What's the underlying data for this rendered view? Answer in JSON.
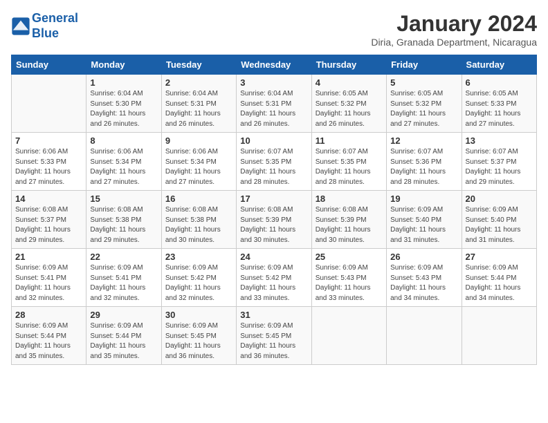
{
  "header": {
    "logo_line1": "General",
    "logo_line2": "Blue",
    "title": "January 2024",
    "subtitle": "Diria, Granada Department, Nicaragua"
  },
  "days_of_week": [
    "Sunday",
    "Monday",
    "Tuesday",
    "Wednesday",
    "Thursday",
    "Friday",
    "Saturday"
  ],
  "weeks": [
    [
      {
        "day": "",
        "info": ""
      },
      {
        "day": "1",
        "info": "Sunrise: 6:04 AM\nSunset: 5:30 PM\nDaylight: 11 hours\nand 26 minutes."
      },
      {
        "day": "2",
        "info": "Sunrise: 6:04 AM\nSunset: 5:31 PM\nDaylight: 11 hours\nand 26 minutes."
      },
      {
        "day": "3",
        "info": "Sunrise: 6:04 AM\nSunset: 5:31 PM\nDaylight: 11 hours\nand 26 minutes."
      },
      {
        "day": "4",
        "info": "Sunrise: 6:05 AM\nSunset: 5:32 PM\nDaylight: 11 hours\nand 26 minutes."
      },
      {
        "day": "5",
        "info": "Sunrise: 6:05 AM\nSunset: 5:32 PM\nDaylight: 11 hours\nand 27 minutes."
      },
      {
        "day": "6",
        "info": "Sunrise: 6:05 AM\nSunset: 5:33 PM\nDaylight: 11 hours\nand 27 minutes."
      }
    ],
    [
      {
        "day": "7",
        "info": "Sunrise: 6:06 AM\nSunset: 5:33 PM\nDaylight: 11 hours\nand 27 minutes."
      },
      {
        "day": "8",
        "info": "Sunrise: 6:06 AM\nSunset: 5:34 PM\nDaylight: 11 hours\nand 27 minutes."
      },
      {
        "day": "9",
        "info": "Sunrise: 6:06 AM\nSunset: 5:34 PM\nDaylight: 11 hours\nand 27 minutes."
      },
      {
        "day": "10",
        "info": "Sunrise: 6:07 AM\nSunset: 5:35 PM\nDaylight: 11 hours\nand 28 minutes."
      },
      {
        "day": "11",
        "info": "Sunrise: 6:07 AM\nSunset: 5:35 PM\nDaylight: 11 hours\nand 28 minutes."
      },
      {
        "day": "12",
        "info": "Sunrise: 6:07 AM\nSunset: 5:36 PM\nDaylight: 11 hours\nand 28 minutes."
      },
      {
        "day": "13",
        "info": "Sunrise: 6:07 AM\nSunset: 5:37 PM\nDaylight: 11 hours\nand 29 minutes."
      }
    ],
    [
      {
        "day": "14",
        "info": "Sunrise: 6:08 AM\nSunset: 5:37 PM\nDaylight: 11 hours\nand 29 minutes."
      },
      {
        "day": "15",
        "info": "Sunrise: 6:08 AM\nSunset: 5:38 PM\nDaylight: 11 hours\nand 29 minutes."
      },
      {
        "day": "16",
        "info": "Sunrise: 6:08 AM\nSunset: 5:38 PM\nDaylight: 11 hours\nand 30 minutes."
      },
      {
        "day": "17",
        "info": "Sunrise: 6:08 AM\nSunset: 5:39 PM\nDaylight: 11 hours\nand 30 minutes."
      },
      {
        "day": "18",
        "info": "Sunrise: 6:08 AM\nSunset: 5:39 PM\nDaylight: 11 hours\nand 30 minutes."
      },
      {
        "day": "19",
        "info": "Sunrise: 6:09 AM\nSunset: 5:40 PM\nDaylight: 11 hours\nand 31 minutes."
      },
      {
        "day": "20",
        "info": "Sunrise: 6:09 AM\nSunset: 5:40 PM\nDaylight: 11 hours\nand 31 minutes."
      }
    ],
    [
      {
        "day": "21",
        "info": "Sunrise: 6:09 AM\nSunset: 5:41 PM\nDaylight: 11 hours\nand 32 minutes."
      },
      {
        "day": "22",
        "info": "Sunrise: 6:09 AM\nSunset: 5:41 PM\nDaylight: 11 hours\nand 32 minutes."
      },
      {
        "day": "23",
        "info": "Sunrise: 6:09 AM\nSunset: 5:42 PM\nDaylight: 11 hours\nand 32 minutes."
      },
      {
        "day": "24",
        "info": "Sunrise: 6:09 AM\nSunset: 5:42 PM\nDaylight: 11 hours\nand 33 minutes."
      },
      {
        "day": "25",
        "info": "Sunrise: 6:09 AM\nSunset: 5:43 PM\nDaylight: 11 hours\nand 33 minutes."
      },
      {
        "day": "26",
        "info": "Sunrise: 6:09 AM\nSunset: 5:43 PM\nDaylight: 11 hours\nand 34 minutes."
      },
      {
        "day": "27",
        "info": "Sunrise: 6:09 AM\nSunset: 5:44 PM\nDaylight: 11 hours\nand 34 minutes."
      }
    ],
    [
      {
        "day": "28",
        "info": "Sunrise: 6:09 AM\nSunset: 5:44 PM\nDaylight: 11 hours\nand 35 minutes."
      },
      {
        "day": "29",
        "info": "Sunrise: 6:09 AM\nSunset: 5:44 PM\nDaylight: 11 hours\nand 35 minutes."
      },
      {
        "day": "30",
        "info": "Sunrise: 6:09 AM\nSunset: 5:45 PM\nDaylight: 11 hours\nand 36 minutes."
      },
      {
        "day": "31",
        "info": "Sunrise: 6:09 AM\nSunset: 5:45 PM\nDaylight: 11 hours\nand 36 minutes."
      },
      {
        "day": "",
        "info": ""
      },
      {
        "day": "",
        "info": ""
      },
      {
        "day": "",
        "info": ""
      }
    ]
  ]
}
